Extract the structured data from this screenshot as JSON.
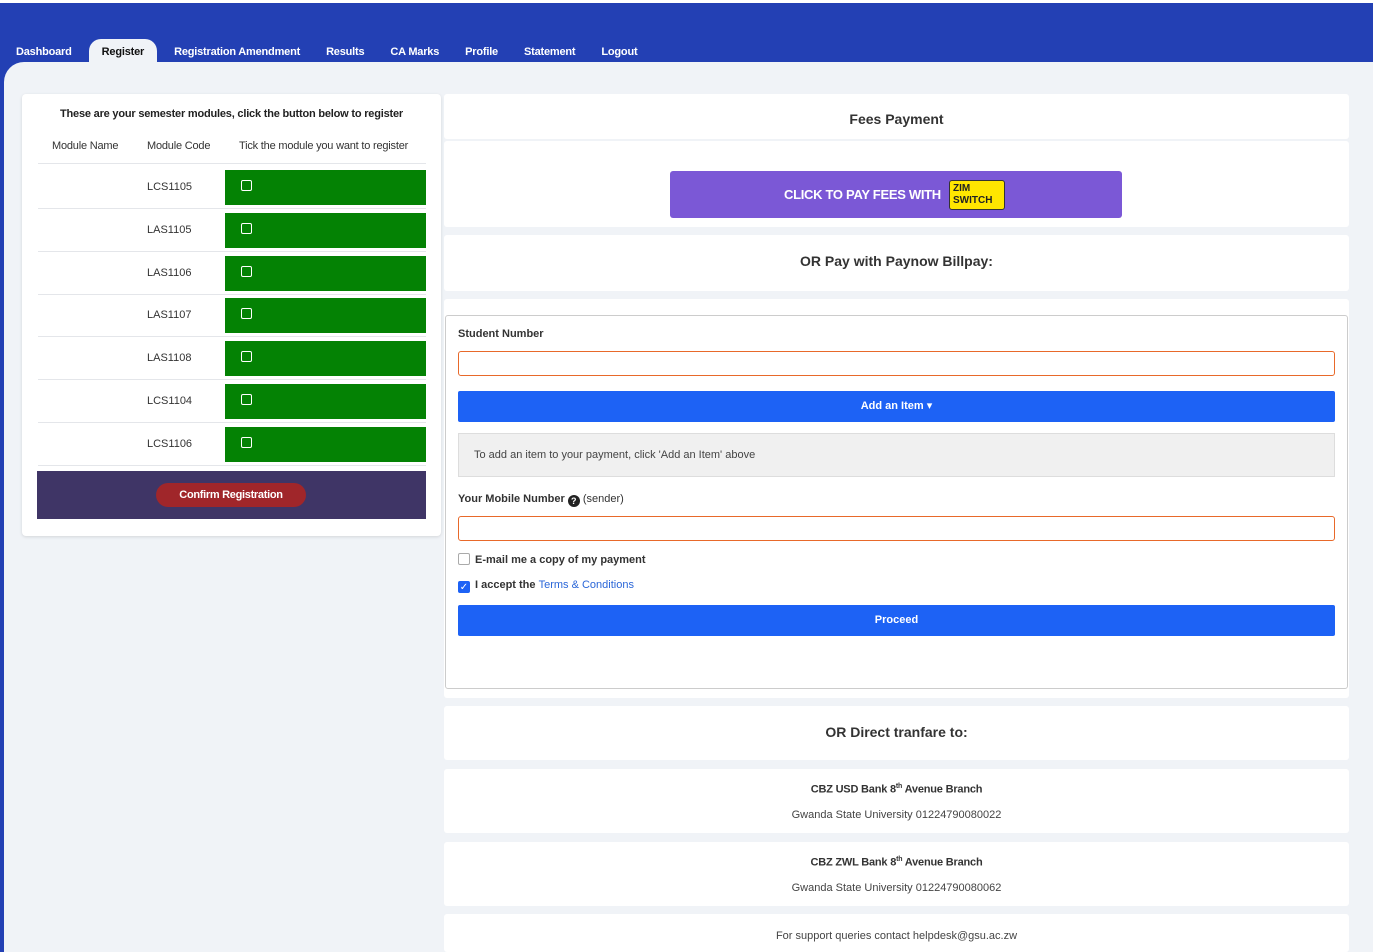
{
  "nav": {
    "tabs": [
      {
        "label": "Dashboard"
      },
      {
        "label": "Register"
      },
      {
        "label": "Registration Amendment"
      },
      {
        "label": "Results"
      },
      {
        "label": "CA Marks"
      },
      {
        "label": "Profile"
      },
      {
        "label": "Statement"
      },
      {
        "label": "Logout"
      }
    ],
    "active_tab": "Register"
  },
  "registration": {
    "intro": "These are your semester modules, click the button below to register",
    "columns": [
      "Module Name",
      "Module Code",
      "Tick the module you want to register"
    ],
    "modules": [
      {
        "name": "",
        "code": "LCS1105",
        "checked": false
      },
      {
        "name": "",
        "code": "LAS1105",
        "checked": false
      },
      {
        "name": "",
        "code": "LAS1106",
        "checked": false
      },
      {
        "name": "",
        "code": "LAS1107",
        "checked": false
      },
      {
        "name": "",
        "code": "LAS1108",
        "checked": false
      },
      {
        "name": "",
        "code": "LCS1104",
        "checked": false
      },
      {
        "name": "",
        "code": "LCS1106",
        "checked": false
      }
    ],
    "confirm_label": "Confirm Registration"
  },
  "payment": {
    "title": "Fees Payment",
    "zimswitch_label": "CLICK TO PAY FEES WITH",
    "zimswitch_logo": "ZIM SWITCH",
    "paynow_title": "OR Pay with Paynow Billpay:",
    "student_number_label": "Student Number",
    "student_number_value": "",
    "add_item_label": "Add an Item",
    "add_item_hint": "To add an item to your payment, click 'Add an Item' above",
    "mobile_label": "Your Mobile Number",
    "mobile_suffix": "(sender)",
    "mobile_value": "",
    "email_copy_label": "E-mail me a copy of my payment",
    "email_copy_checked": false,
    "accept_prefix": "I accept the",
    "terms_link": "Terms & Conditions",
    "accept_checked": true,
    "proceed_label": "Proceed"
  },
  "transfer": {
    "title": "OR Direct tranfare to:",
    "banks": [
      {
        "name_pre": "CBZ USD Bank 8",
        "name_sup": "th",
        "name_post": " Avenue Branch",
        "account": "Gwanda State University 01224790080022"
      },
      {
        "name_pre": "CBZ ZWL Bank 8",
        "name_sup": "th",
        "name_post": " Avenue Branch",
        "account": "Gwanda State University 01224790080062"
      }
    ],
    "support": "For support queries contact helpdesk@gsu.ac.zw"
  },
  "colors": {
    "nav_bg": "#2340b4",
    "tick_green": "#048204",
    "confirm_bar": "#3f3566",
    "confirm_button": "#a0262a",
    "zimswitch_purple": "#7b58d6",
    "primary_blue": "#1d62f5",
    "input_border": "#e8692a"
  }
}
